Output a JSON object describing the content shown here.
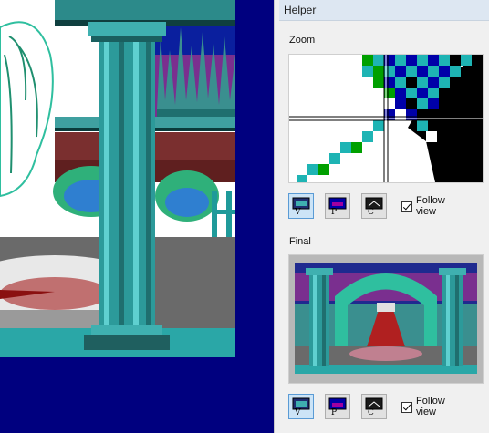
{
  "helper_panel": {
    "title": "Helper",
    "zoom": {
      "label": "Zoom",
      "follow_line1": "Follow",
      "follow_line2": "view",
      "follow_checked": true
    },
    "final": {
      "label": "Final",
      "follow_line1": "Follow",
      "follow_line2": "view",
      "follow_checked": true
    },
    "tool_buttons": [
      {
        "key": "V",
        "icon": "visual-screen-icon"
      },
      {
        "key": "P",
        "icon": "priority-screen-icon"
      },
      {
        "key": "C",
        "icon": "control-screen-icon"
      }
    ]
  },
  "colors": {
    "canvas_bg": "#00007f",
    "panel_bg": "#f0f0f0",
    "titlebar_bg": "#dde7f2",
    "active_button": "#cce4f7"
  }
}
